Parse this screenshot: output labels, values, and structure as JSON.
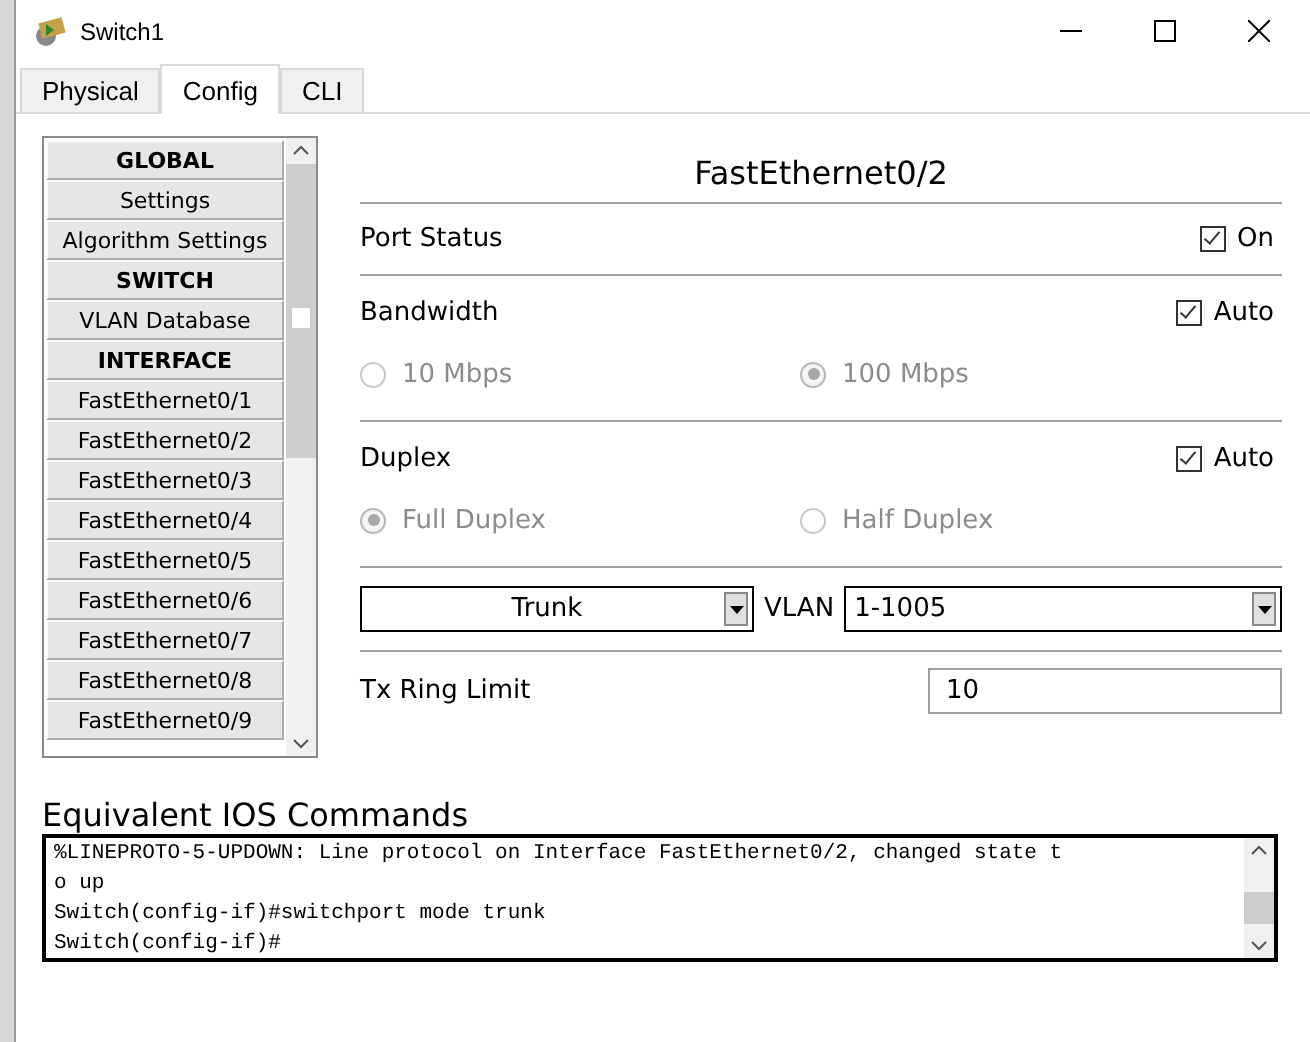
{
  "window": {
    "title": "Switch1"
  },
  "tabs": [
    {
      "label": "Physical",
      "selected": false
    },
    {
      "label": "Config",
      "selected": true
    },
    {
      "label": "CLI",
      "selected": false
    }
  ],
  "sidebar": {
    "items": [
      {
        "kind": "header",
        "label": "GLOBAL",
        "selected": false
      },
      {
        "kind": "item",
        "label": "Settings",
        "selected": false
      },
      {
        "kind": "item",
        "label": "Algorithm Settings",
        "selected": false
      },
      {
        "kind": "header",
        "label": "SWITCH",
        "selected": false
      },
      {
        "kind": "item",
        "label": "VLAN Database",
        "selected": false
      },
      {
        "kind": "header",
        "label": "INTERFACE",
        "selected": false
      },
      {
        "kind": "item",
        "label": "FastEthernet0/1",
        "selected": false
      },
      {
        "kind": "item",
        "label": "FastEthernet0/2",
        "selected": false
      },
      {
        "kind": "item",
        "label": "FastEthernet0/3",
        "selected": false
      },
      {
        "kind": "item",
        "label": "FastEthernet0/4",
        "selected": false
      },
      {
        "kind": "item",
        "label": "FastEthernet0/5",
        "selected": false
      },
      {
        "kind": "item",
        "label": "FastEthernet0/6",
        "selected": false
      },
      {
        "kind": "item",
        "label": "FastEthernet0/7",
        "selected": false
      },
      {
        "kind": "item",
        "label": "FastEthernet0/8",
        "selected": false
      },
      {
        "kind": "item",
        "label": "FastEthernet0/9",
        "selected": false
      }
    ]
  },
  "panel": {
    "title": "FastEthernet0/2",
    "port_status": {
      "label": "Port Status",
      "checkbox": {
        "label": "On",
        "checked": true
      }
    },
    "bandwidth": {
      "label": "Bandwidth",
      "auto": {
        "label": "Auto",
        "checked": true
      },
      "options": [
        {
          "label": "10 Mbps",
          "selected": false,
          "disabled": true
        },
        {
          "label": "100 Mbps",
          "selected": true,
          "disabled": true
        }
      ]
    },
    "duplex": {
      "label": "Duplex",
      "auto": {
        "label": "Auto",
        "checked": true
      },
      "options": [
        {
          "label": "Full Duplex",
          "selected": true,
          "disabled": true
        },
        {
          "label": "Half Duplex",
          "selected": false,
          "disabled": true
        }
      ]
    },
    "mode": {
      "value": "Trunk"
    },
    "vlan": {
      "label": "VLAN",
      "value": "1-1005"
    },
    "tx_ring_limit": {
      "label": "Tx Ring Limit",
      "value": "10"
    }
  },
  "ios_commands": {
    "title": "Equivalent IOS Commands",
    "lines": [
      "%LINEPROTO-5-UPDOWN: Line protocol on Interface FastEthernet0/2, changed state t",
      "o up",
      "Switch(config-if)#switchport mode trunk",
      "Switch(config-if)#"
    ]
  }
}
